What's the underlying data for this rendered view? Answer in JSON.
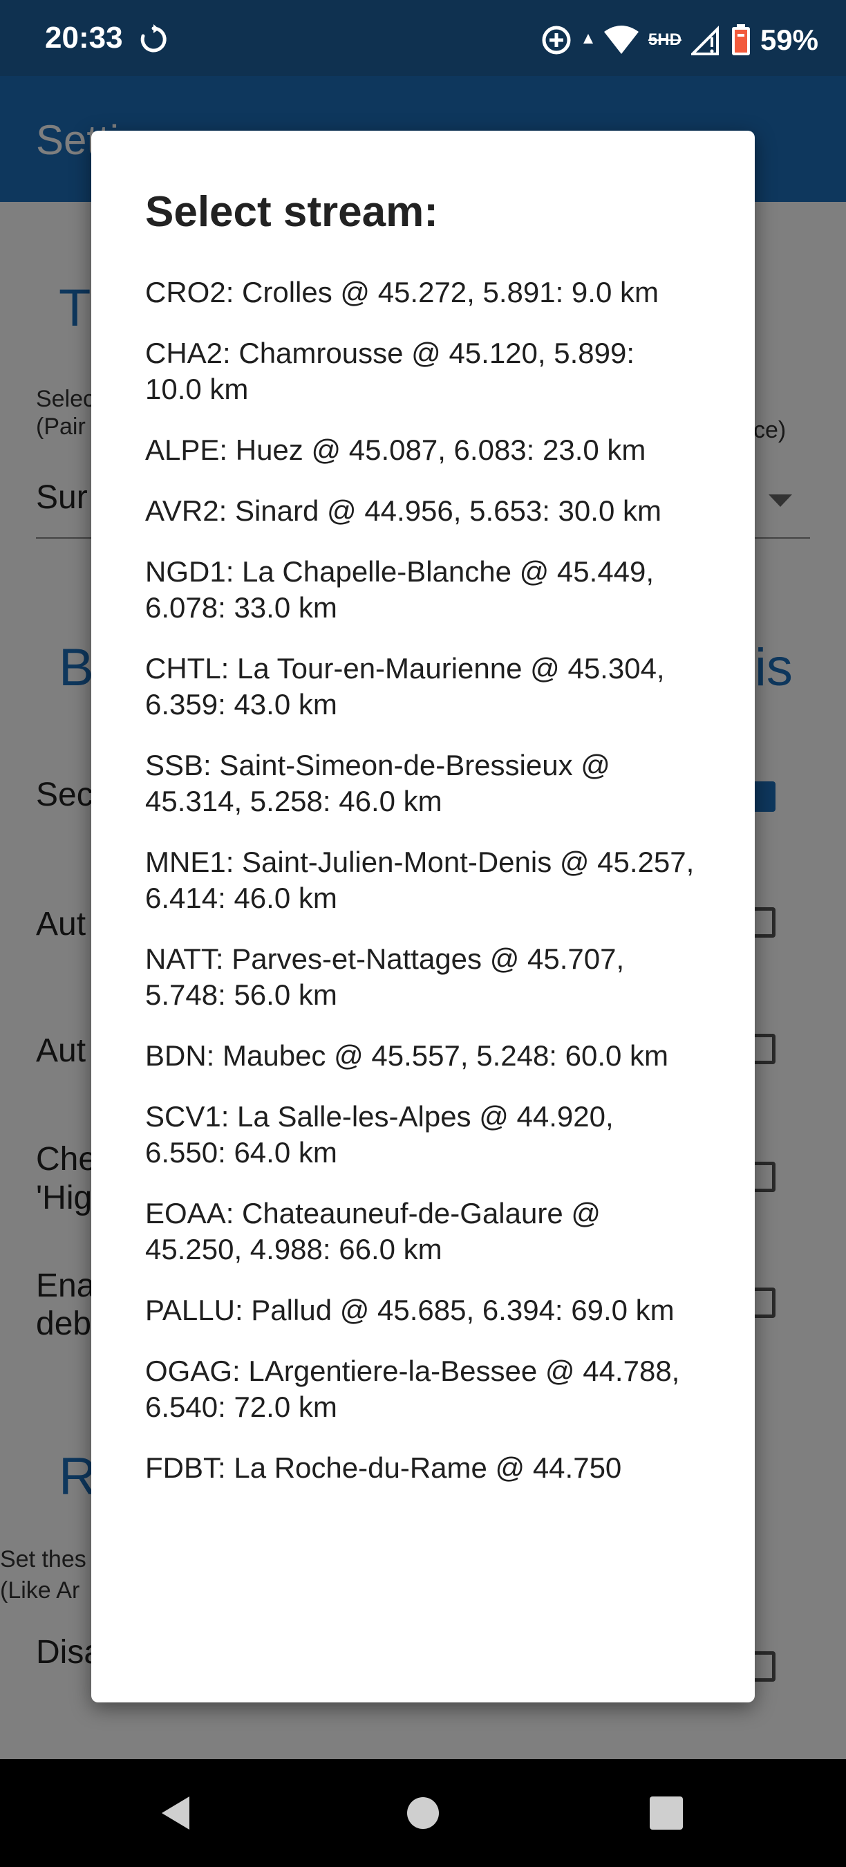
{
  "status_bar": {
    "time": "20:33",
    "battery": "59%",
    "network": "5HD"
  },
  "app": {
    "title": "Setti"
  },
  "background": {
    "section1_title": "T",
    "select_label_line1": "Selec",
    "select_label_line2": "(Pair",
    "select_label_right": "ce)",
    "spinner_value": "Sur",
    "section2_title": "B",
    "section2_title_right": "is",
    "row1": "Sec",
    "row2": "Aut",
    "row3": "Aut",
    "row4_line1": "Che",
    "row4_line2": "'Hig",
    "row5_line1": "Ena",
    "row5_line2": "deb",
    "section3_title": "R",
    "set_line1": "Set thes",
    "set_line2": "(Like Ar",
    "row6": "Disa"
  },
  "dialog": {
    "title": "Select stream:",
    "streams": [
      "CRO2: Crolles @ 45.272, 5.891: 9.0 km",
      "CHA2: Chamrousse @ 45.120, 5.899: 10.0 km",
      "ALPE: Huez @ 45.087, 6.083: 23.0 km",
      "AVR2: Sinard @ 44.956, 5.653: 30.0 km",
      "NGD1: La Chapelle-Blanche @ 45.449, 6.078: 33.0 km",
      "CHTL: La Tour-en-Maurienne @ 45.304, 6.359: 43.0 km",
      "SSB: Saint-Simeon-de-Bressieux @ 45.314, 5.258: 46.0 km",
      "MNE1: Saint-Julien-Mont-Denis @ 45.257, 6.414: 46.0 km",
      "NATT: Parves-et-Nattages @ 45.707, 5.748: 56.0 km",
      "BDN: Maubec @ 45.557, 5.248: 60.0 km",
      "SCV1: La Salle-les-Alpes @ 44.920, 6.550: 64.0 km",
      "EOAA: Chateauneuf-de-Galaure @ 45.250, 4.988: 66.0 km",
      "PALLU: Pallud @ 45.685, 6.394: 69.0 km",
      "OGAG: LArgentiere-la-Bessee @ 44.788, 6.540: 72.0 km",
      "FDBT: La Roche-du-Rame @ 44.750"
    ]
  },
  "navigation": {
    "back": "back-icon",
    "home": "home-icon",
    "recents": "recents-icon"
  },
  "colors": {
    "status_bar": "#0f3150",
    "app_bar": "#1d6fbb",
    "accent": "#1d6fbb",
    "battery": "#f25a3c"
  }
}
